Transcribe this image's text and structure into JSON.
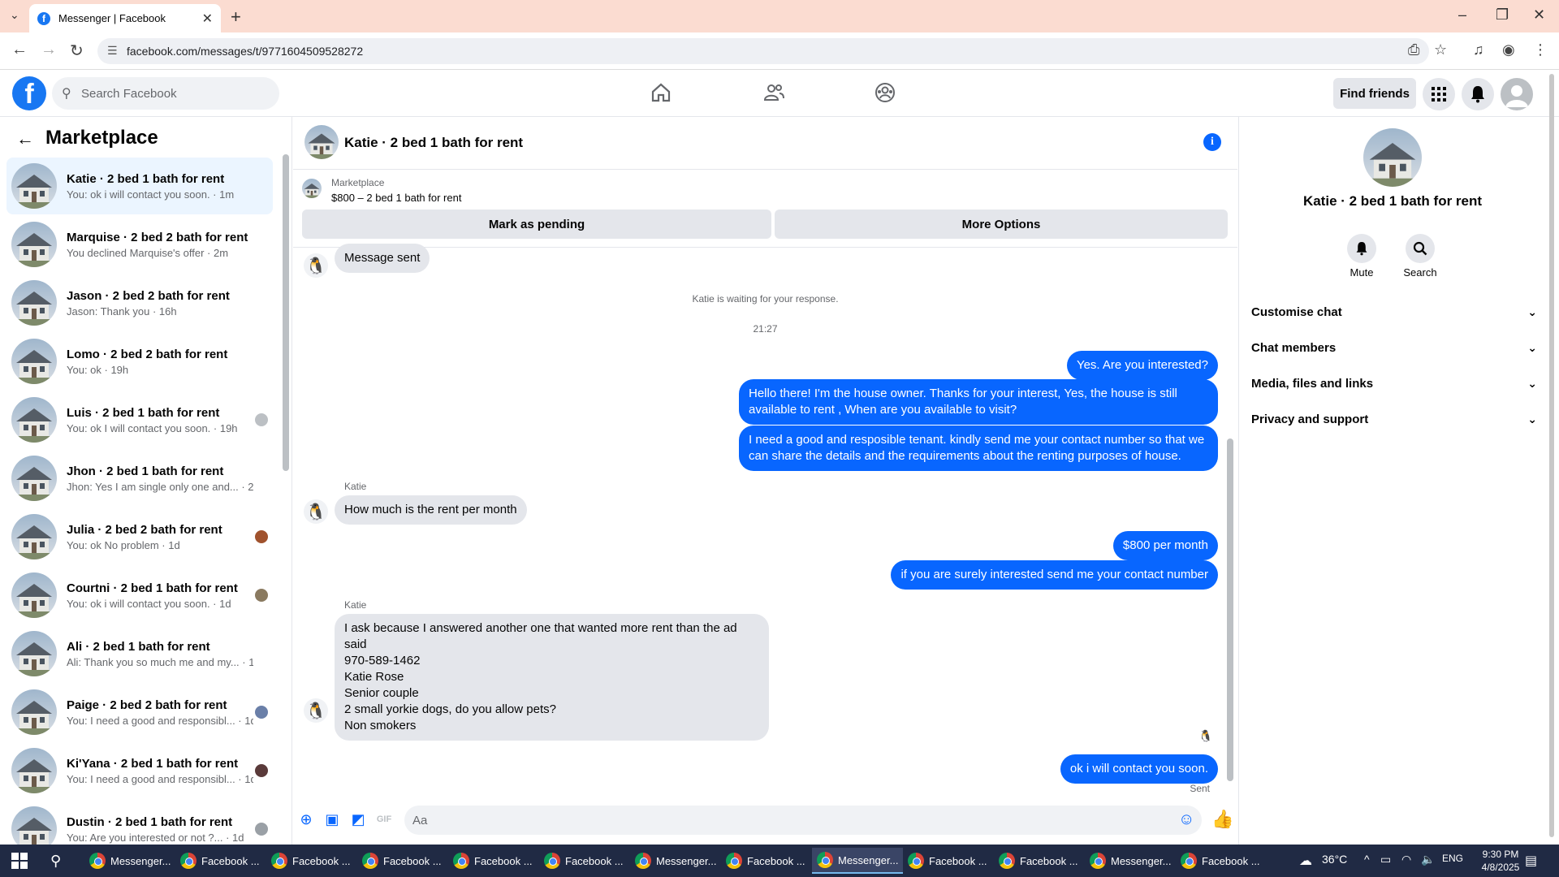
{
  "browser": {
    "tab_title": "Messenger | Facebook",
    "url": "facebook.com/messages/t/9771604509528272"
  },
  "header": {
    "search_placeholder": "Search Facebook",
    "find_friends": "Find friends"
  },
  "sidebar": {
    "title": "Marketplace",
    "conversations": [
      {
        "name": "Katie · 2 bed 1 bath for rent",
        "preview": "You: ok i will contact you soon. · 1m",
        "active": true
      },
      {
        "name": "Marquise · 2 bed 2 bath for rent",
        "preview": "You declined Marquise's offer · 2m"
      },
      {
        "name": "Jason · 2 bed 2 bath for rent",
        "preview": "Jason: Thank you · 16h"
      },
      {
        "name": "Lomo · 2 bed 2 bath for rent",
        "preview": "You: ok · 19h"
      },
      {
        "name": "Luis · 2 bed 1 bath for rent",
        "preview": "You: ok I will contact you soon. · 19h"
      },
      {
        "name": "Jhon · 2 bed 1 bath for rent",
        "preview": "Jhon: Yes I am single only one and... · 23h"
      },
      {
        "name": "Julia · 2 bed 2 bath for rent",
        "preview": "You: ok No problem · 1d"
      },
      {
        "name": "Courtni · 2 bed 1 bath for rent",
        "preview": "You: ok i will contact you soon. · 1d"
      },
      {
        "name": "Ali · 2 bed 1 bath for rent",
        "preview": "Ali: Thank you so much me and my... · 1d"
      },
      {
        "name": "Paige · 2 bed 2 bath for rent",
        "preview": "You: I need a good and responsibl... · 1d"
      },
      {
        "name": "Ki'Yana · 2 bed 1 bath for rent",
        "preview": "You: I need a good and responsibl... · 1d"
      },
      {
        "name": "Dustin · 2 bed 1 bath for rent",
        "preview": "You: Are you interested or not ?... · 1d"
      }
    ]
  },
  "chat": {
    "title": "Katie · 2 bed 1 bath for rent",
    "marketplace_label": "Marketplace",
    "listing": "$800 – 2 bed 1 bath for rent",
    "btn_pending": "Mark as pending",
    "btn_more": "More Options",
    "msg_sent": "Message sent",
    "waiting": "Katie is waiting for your response.",
    "time": "21:27",
    "out1": "Yes. Are you interested?",
    "out2": "Hello there! I'm the house owner. Thanks for your interest, Yes, the house is still available to rent , When are you available to visit?",
    "out3": "I need a good and resposible tenant.  kindly send me your contact number so that we can share the details and the requirements about the renting purposes of house.",
    "sender": "Katie",
    "in1": "How much is the rent per month",
    "out4": "$800 per month",
    "out5": "if you are surely interested send me your contact number",
    "in2_lines": [
      "I ask because I answered another one that wanted more rent than the ad said",
      "970-589-1462",
      "Katie Rose",
      "Senior couple",
      "2 small yorkie dogs, do you allow pets?",
      "Non smokers"
    ],
    "out6": "ok i will contact you soon.",
    "status": "Sent",
    "composer_placeholder": "Aa"
  },
  "right_panel": {
    "name": "Katie · 2 bed 1 bath for rent",
    "mute": "Mute",
    "search": "Search",
    "rows": [
      "Customise chat",
      "Chat members",
      "Media, files and links",
      "Privacy and support"
    ]
  },
  "taskbar": {
    "items": [
      "Messenger...",
      "Facebook ...",
      "Facebook ...",
      "Facebook ...",
      "Facebook ...",
      "Facebook ...",
      "Messenger...",
      "Facebook ...",
      "Messenger...",
      "Facebook ...",
      "Facebook ...",
      "Messenger...",
      "Facebook ..."
    ],
    "weather": "36°C",
    "lang": "ENG",
    "clock_time": "9:30 PM",
    "clock_date": "4/8/2025"
  },
  "colors": {
    "brand": "#1877f2",
    "bubble_out": "#0866ff",
    "bubble_in": "#e4e6eb",
    "active_conv": "#ebf5ff"
  }
}
